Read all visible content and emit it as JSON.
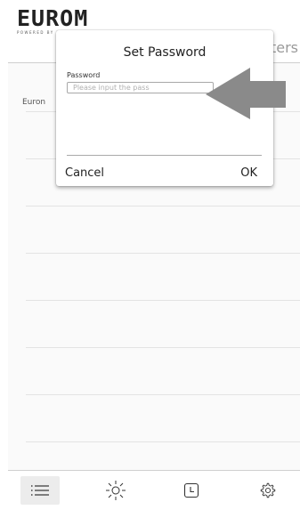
{
  "header": {
    "logo": "EUROM",
    "logo_tag": "POWERED BY PRODUCTS",
    "title": "Heaters"
  },
  "list": {
    "first_item_label": "Euron"
  },
  "dialog": {
    "title": "Set Password",
    "password_label": "Password",
    "password_placeholder": "Please input the pass",
    "cancel_label": "Cancel",
    "ok_label": "OK"
  },
  "tabs": [
    {
      "icon": "list-icon",
      "active": true
    },
    {
      "icon": "sun-icon",
      "active": false
    },
    {
      "icon": "clock-icon",
      "active": false
    },
    {
      "icon": "gear-icon",
      "active": false
    }
  ],
  "colors": {
    "arrow": "#8a8a8a",
    "divider": "#e3e3e3",
    "header_title": "#9a9a9a"
  }
}
